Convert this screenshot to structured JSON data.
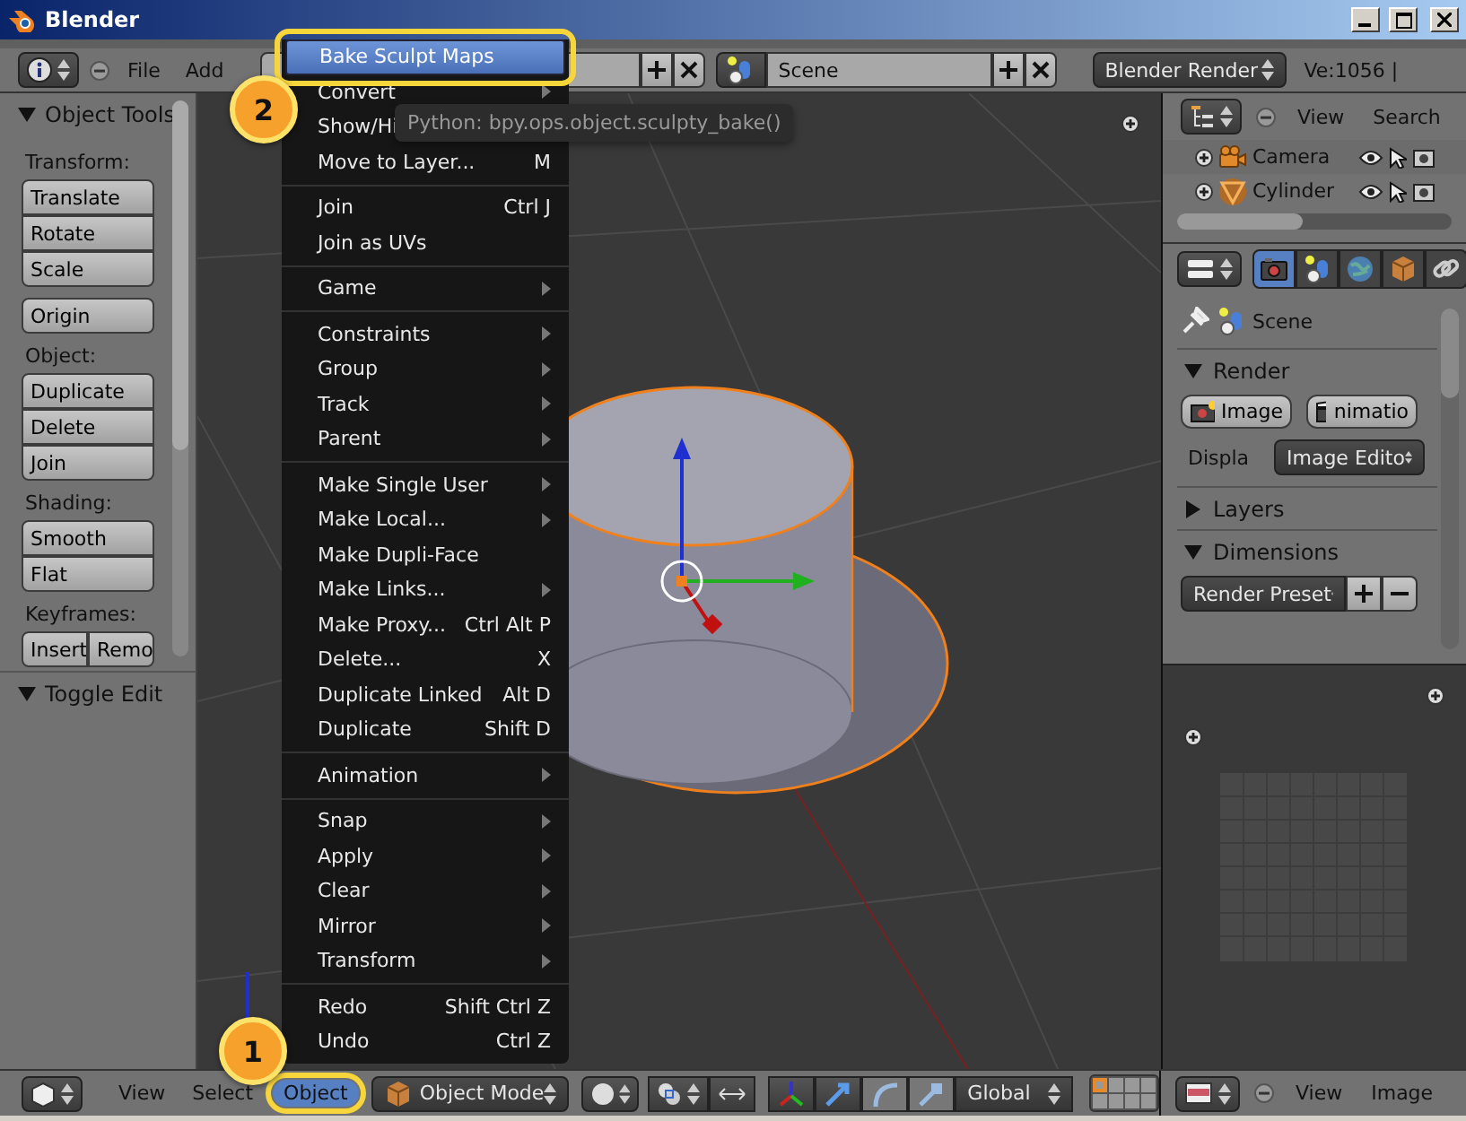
{
  "window": {
    "title": "Blender"
  },
  "top_header": {
    "menus": [
      "File",
      "Add"
    ],
    "scene": "Scene",
    "render_engine": "Blender Render",
    "stats": "Ve:1056 |"
  },
  "tool_shelf": {
    "panels": [
      {
        "title": "Object Tools",
        "expanded": true,
        "sections": [
          {
            "label": "Transform:",
            "row": false,
            "buttons": [
              "Translate",
              "Rotate",
              "Scale"
            ]
          },
          {
            "row": false,
            "buttons": [
              "Origin"
            ]
          },
          {
            "label": "Object:",
            "row": false,
            "buttons": [
              "Duplicate",
              "Delete",
              "Join"
            ]
          },
          {
            "label": "Shading:",
            "row": false,
            "buttons": [
              "Smooth",
              "Flat"
            ]
          },
          {
            "label": "Keyframes:",
            "row": true,
            "buttons": [
              "Insert",
              "Remo"
            ]
          }
        ]
      },
      {
        "title": "Toggle Edit",
        "expanded": true
      }
    ]
  },
  "object_menu": {
    "groups": [
      [
        {
          "label": "Bake Sculpt Maps",
          "selected": true,
          "submenu": false
        },
        {
          "label": "Convert",
          "selected": false,
          "submenu": true
        },
        {
          "label": "Show/Hi",
          "selected": false,
          "submenu": false
        },
        {
          "label": "Move to Layer...",
          "shortcut": "M",
          "selected": false,
          "submenu": false
        }
      ],
      [
        {
          "label": "Join",
          "shortcut": "Ctrl J",
          "selected": false,
          "submenu": false
        },
        {
          "label": "Join as UVs",
          "selected": false,
          "submenu": false
        }
      ],
      [
        {
          "label": "Game",
          "selected": false,
          "submenu": true
        }
      ],
      [
        {
          "label": "Constraints",
          "selected": false,
          "submenu": true
        },
        {
          "label": "Group",
          "selected": false,
          "submenu": true
        },
        {
          "label": "Track",
          "selected": false,
          "submenu": true
        },
        {
          "label": "Parent",
          "selected": false,
          "submenu": true
        }
      ],
      [
        {
          "label": "Make Single User",
          "selected": false,
          "submenu": true
        },
        {
          "label": "Make Local...",
          "selected": false,
          "submenu": true
        },
        {
          "label": "Make Dupli-Face",
          "selected": false,
          "submenu": false
        },
        {
          "label": "Make Links...",
          "selected": false,
          "submenu": true
        },
        {
          "label": "Make Proxy...",
          "shortcut": "Ctrl Alt P",
          "selected": false,
          "submenu": false
        },
        {
          "label": "Delete...",
          "shortcut": "X",
          "selected": false,
          "submenu": false
        },
        {
          "label": "Duplicate Linked",
          "shortcut": "Alt D",
          "selected": false,
          "submenu": false
        },
        {
          "label": "Duplicate",
          "shortcut": "Shift D",
          "selected": false,
          "submenu": false
        }
      ],
      [
        {
          "label": "Animation",
          "selected": false,
          "submenu": true
        }
      ],
      [
        {
          "label": "Snap",
          "selected": false,
          "submenu": true
        },
        {
          "label": "Apply",
          "selected": false,
          "submenu": true
        },
        {
          "label": "Clear",
          "selected": false,
          "submenu": true
        },
        {
          "label": "Mirror",
          "selected": false,
          "submenu": true
        },
        {
          "label": "Transform",
          "selected": false,
          "submenu": true
        }
      ],
      [
        {
          "label": "Redo",
          "shortcut": "Shift Ctrl Z",
          "selected": false,
          "submenu": false
        },
        {
          "label": "Undo",
          "shortcut": "Ctrl Z",
          "selected": false,
          "submenu": false
        }
      ]
    ]
  },
  "tooltip": "Python: bpy.ops.object.sculpty_bake()",
  "outliner": {
    "menus": [
      "View",
      "Search"
    ],
    "rows": [
      {
        "name": "Camera",
        "kind": "camera"
      },
      {
        "name": "Cylinder",
        "kind": "mesh"
      }
    ]
  },
  "properties": {
    "tabs": [
      {
        "kind": "render",
        "selected": true
      },
      {
        "kind": "scene",
        "selected": false
      },
      {
        "kind": "world",
        "selected": false
      },
      {
        "kind": "object",
        "selected": false
      },
      {
        "kind": "constraints",
        "selected": false
      }
    ],
    "path": "Scene",
    "panels": [
      {
        "title": "Render",
        "expanded": true,
        "kind": "render",
        "buttons": [
          "Image",
          "nimatio"
        ],
        "display_label": "Displa",
        "display_value": "Image Edito"
      },
      {
        "title": "Layers",
        "expanded": false
      },
      {
        "title": "Dimensions",
        "expanded": true,
        "kind": "dimensions",
        "preset": "Render Preset"
      }
    ]
  },
  "image_editor": {
    "menus": [
      "View",
      "Image"
    ]
  },
  "bottom_header": {
    "menus": [
      {
        "label": "View",
        "selected": false
      },
      {
        "label": "Select",
        "selected": false
      },
      {
        "label": "Object",
        "selected": true
      }
    ],
    "mode": "Object Mode",
    "orientation": "Global"
  },
  "callouts": [
    {
      "number": "1"
    },
    {
      "number": "2"
    }
  ]
}
